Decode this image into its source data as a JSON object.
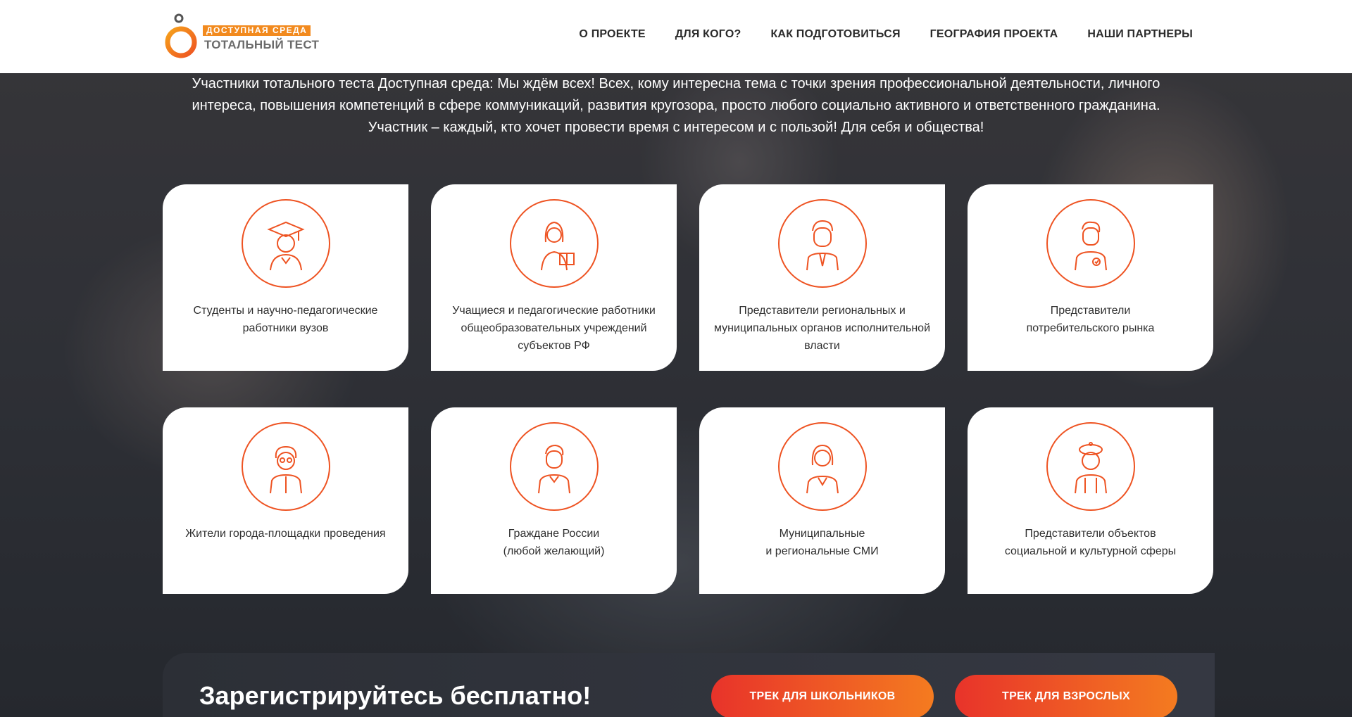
{
  "brand": {
    "top_label": "ДОСТУПНАЯ СРЕДА",
    "bottom_label": "ТОТАЛЬНЫЙ ТЕСТ",
    "accent_color": "#f28a1e",
    "icon_color": "#ee5322"
  },
  "nav": {
    "items": [
      "О ПРОЕКТЕ",
      "ДЛЯ КОГО?",
      "КАК ПОДГОТОВИТЬСЯ",
      "ГЕОГРАФИЯ ПРОЕКТА",
      "НАШИ ПАРТНЕРЫ"
    ]
  },
  "intro": {
    "text": "Участники тотального теста Доступная среда: Мы ждём всех! Всех, кому интересна тема с точки зрения профессиональной деятельности, личного интереса, повышения компетенций в сфере коммуникаций, развития кругозора, просто любого социально активного и ответственного гражданина. Участник – каждый, кто хочет провести время с интересом и с пользой! Для себя и общества!"
  },
  "audiences": [
    {
      "icon": "graduate-icon",
      "label": "Студенты и научно-педагогические\nработники вузов"
    },
    {
      "icon": "teacher-with-book-icon",
      "label": "Учащиеся и педагогические работники\nобщеобразовательных учреждений\nсубъектов РФ"
    },
    {
      "icon": "official-in-suit-icon",
      "label": "Представители региональных и\nмуниципальных органов исполнительной\nвласти"
    },
    {
      "icon": "consumer-badge-icon",
      "label": "Представители\nпотребительского рынка"
    },
    {
      "icon": "elderly-man-icon",
      "label": "Жители города-площадки проведения"
    },
    {
      "icon": "citizen-icon",
      "label": "Граждане России\n(любой желающий)"
    },
    {
      "icon": "journalist-woman-icon",
      "label": "Муниципальные\nи региональные СМИ"
    },
    {
      "icon": "artist-beret-icon",
      "label": "Представители объектов\nсоциальной и культурной сферы"
    }
  ],
  "registration": {
    "title": "Зарегистрируйтесь бесплатно!",
    "school_track": "ТРЕК ДЛЯ ШКОЛЬНИКОВ",
    "adult_track": "ТРЕК ДЛЯ ВЗРОСЛЫХ"
  }
}
